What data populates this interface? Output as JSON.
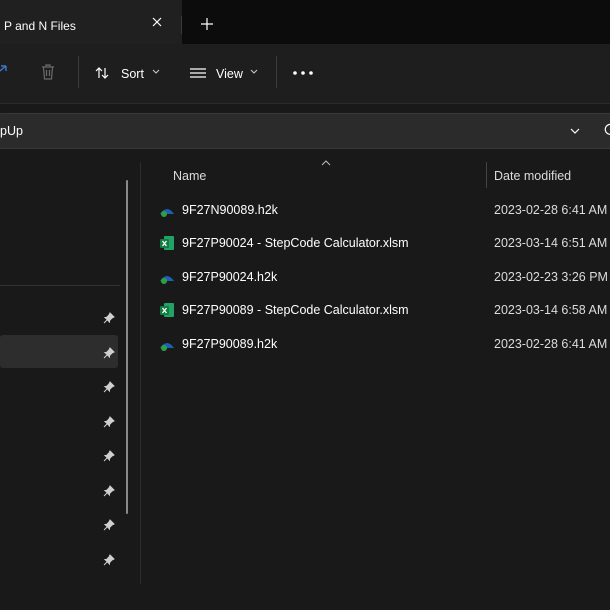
{
  "tab": {
    "title": "P and N Files"
  },
  "icons": {
    "tab_close": "close-icon",
    "new_tab": "plus-icon",
    "share": "share-icon",
    "delete": "trash-icon",
    "sort": "sort-arrows-icon",
    "view": "view-lines-icon",
    "more": "more-dots-icon",
    "chevron": "chevron-down-icon",
    "refresh": "refresh-icon",
    "pin": "pin-icon",
    "h2k_file": "h2k-file-icon",
    "excel_file": "excel-file-icon"
  },
  "toolbar": {
    "sort_label": "Sort",
    "view_label": "View"
  },
  "address": {
    "path": "pUp"
  },
  "columns": {
    "name": "Name",
    "date_modified": "Date modified"
  },
  "files": [
    {
      "name": "9F27N90089.h2k",
      "date": "2023-02-28 6:41 AM",
      "type": "h2k"
    },
    {
      "name": "9F27P90024 - StepCode Calculator.xlsm",
      "date": "2023-03-14 6:51 AM",
      "type": "xlsm"
    },
    {
      "name": "9F27P90024.h2k",
      "date": "2023-02-23 3:26 PM",
      "type": "h2k"
    },
    {
      "name": "9F27P90089 - StepCode Calculator.xlsm",
      "date": "2023-03-14 6:58 AM",
      "type": "xlsm"
    },
    {
      "name": "9F27P90089.h2k",
      "date": "2023-02-28 6:41 AM",
      "type": "h2k"
    }
  ],
  "colors": {
    "background": "#191919",
    "tab_strip": "#0c0c0c",
    "command_bar": "#1e1e1e",
    "selected": "#2d2d2d",
    "excel_green": "#1d7a45",
    "h2k_blue": "#1e5fb5"
  }
}
